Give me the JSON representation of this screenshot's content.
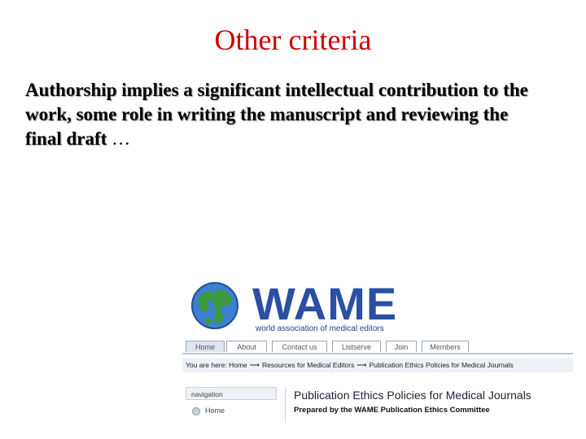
{
  "slide": {
    "title": "Other criteria",
    "body": "Authorship implies a significant intellectual contribution to the work, some role in writing the manuscript and reviewing the final draft",
    "ellipsis": "…"
  },
  "screenshot": {
    "logo": {
      "wordmark": "WAME",
      "subtitle": "world association of medical editors",
      "icon": "globe-icon"
    },
    "tabs": [
      "Home",
      "About",
      "Contact us",
      "Listserve",
      "Join",
      "Members"
    ],
    "breadcrumb": {
      "prefix": "You are here:",
      "items": [
        "Home",
        "Resources for Medical Editors",
        "Publication Ethics Policies for Medical Journals"
      ]
    },
    "navigation": {
      "header": "navigation",
      "items": [
        "Home"
      ]
    },
    "content": {
      "title": "Publication Ethics Policies for Medical Journals",
      "subtitle": "Prepared by the WAME Publication Ethics Committee"
    }
  },
  "colors": {
    "title": "#cc0000",
    "wame_blue": "#2a4fa3"
  }
}
